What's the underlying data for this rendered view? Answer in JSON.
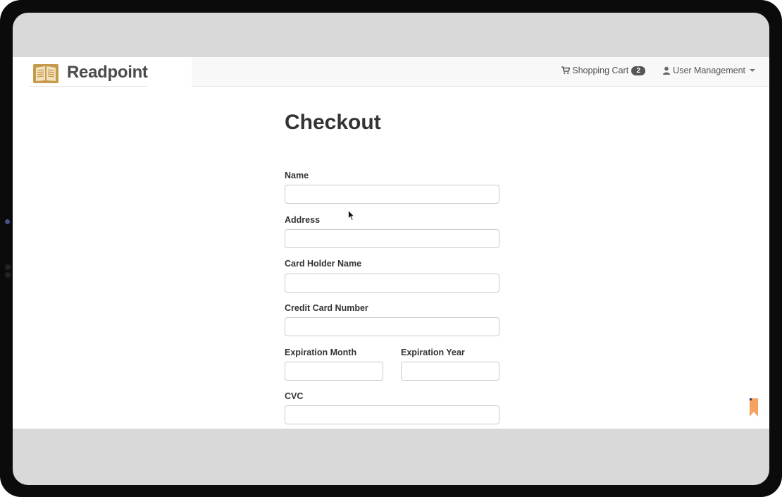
{
  "brand": {
    "name": "Readpoint"
  },
  "nav": {
    "cart_label": "Shopping Cart",
    "cart_count": "2",
    "user_label": "User Management"
  },
  "checkout": {
    "title": "Checkout",
    "fields": {
      "name": {
        "label": "Name",
        "value": ""
      },
      "address": {
        "label": "Address",
        "value": ""
      },
      "card_holder": {
        "label": "Card Holder Name",
        "value": ""
      },
      "card_number": {
        "label": "Credit Card Number",
        "value": ""
      },
      "exp_month": {
        "label": "Expiration Month",
        "value": ""
      },
      "exp_year": {
        "label": "Expiration Year",
        "value": ""
      },
      "cvc": {
        "label": "CVC",
        "value": ""
      }
    },
    "submit_label": ""
  },
  "colors": {
    "brand_gold": "#c59a4a",
    "navbar_bg": "#f8f8f8",
    "button_green": "#5cb85c",
    "bookmark_orange": "#f4a261",
    "frame": "#0b0b0b",
    "screen_bg": "#d9d9d9"
  },
  "icons": {
    "logo": "open-book-icon",
    "cart": "shopping-cart-icon",
    "user": "user-icon",
    "dropdown": "caret-down-icon",
    "bookmark": "bookmark-icon",
    "cursor": "mouse-pointer-icon"
  }
}
